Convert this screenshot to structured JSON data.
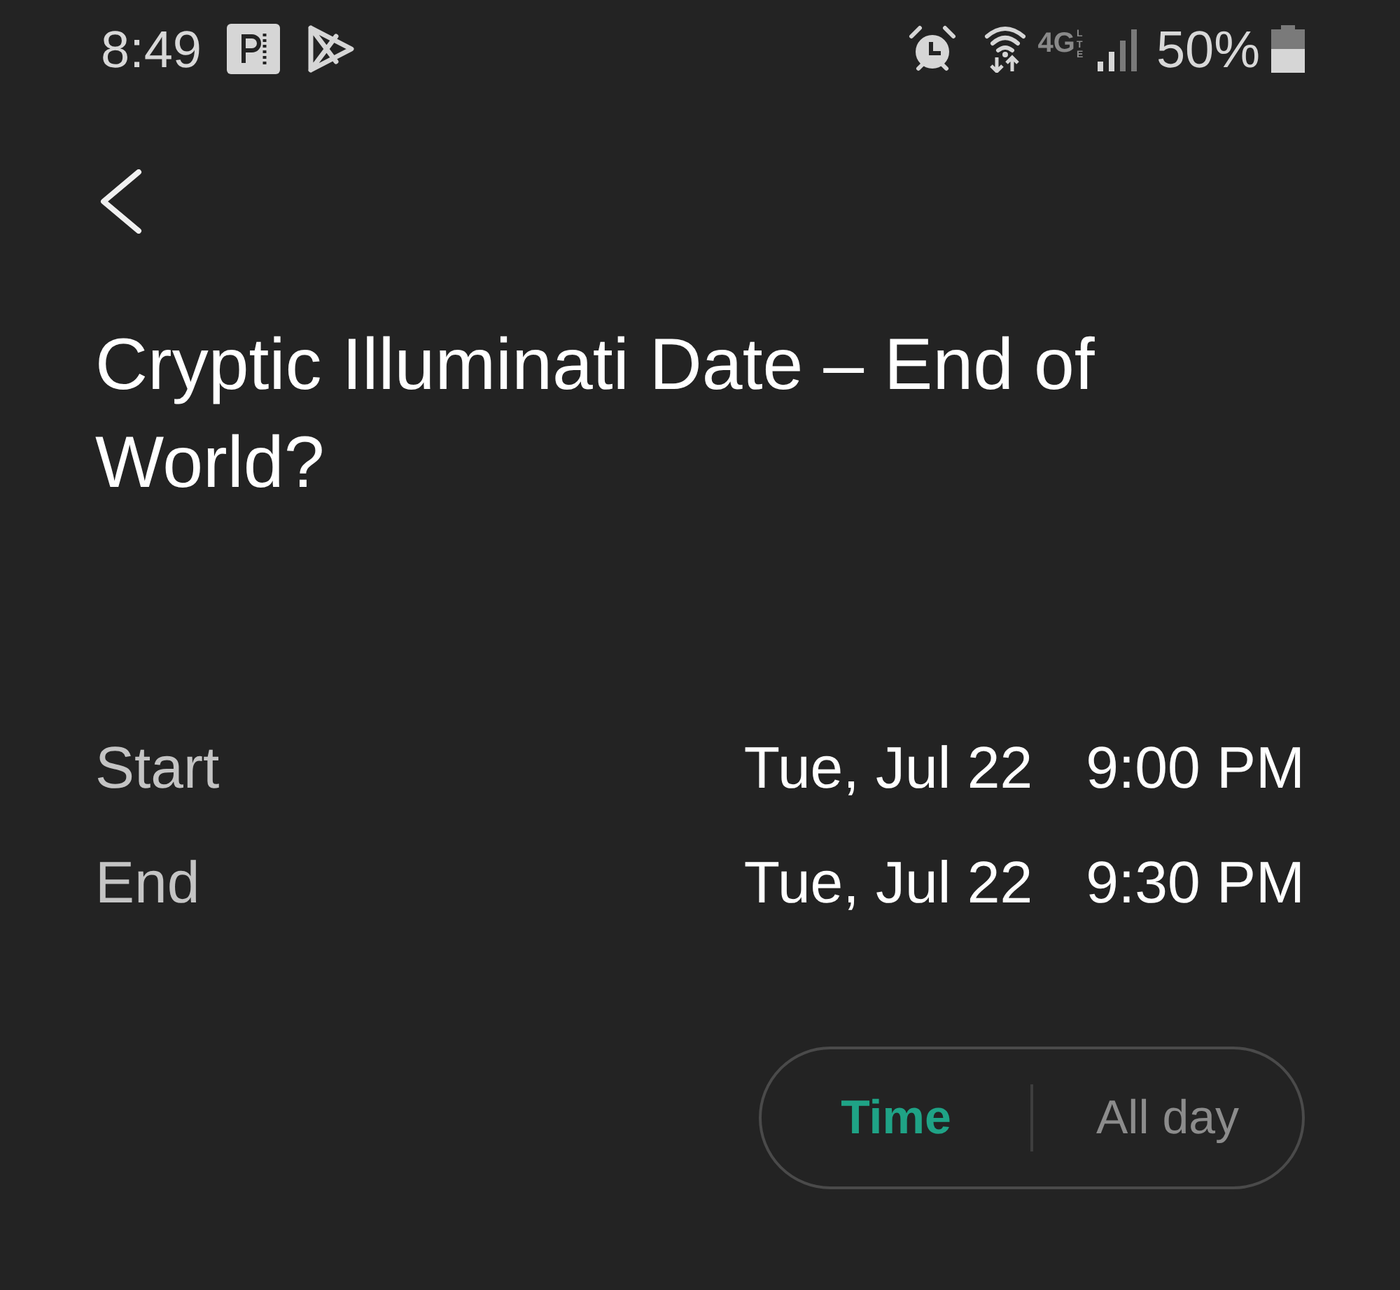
{
  "status_bar": {
    "time": "8:49",
    "network_type": "4G",
    "network_suffix": "LTE",
    "battery": "50%"
  },
  "title": "Cryptic Illuminati Date – End of World?",
  "rows": [
    {
      "label": "Start",
      "date": "Tue, Jul 22",
      "time": "9:00 PM"
    },
    {
      "label": "End",
      "date": "Tue, Jul 22",
      "time": "9:30 PM"
    }
  ],
  "mode_toggle": [
    {
      "label": "Time",
      "selected": true
    },
    {
      "label": "All day",
      "selected": false
    }
  ]
}
